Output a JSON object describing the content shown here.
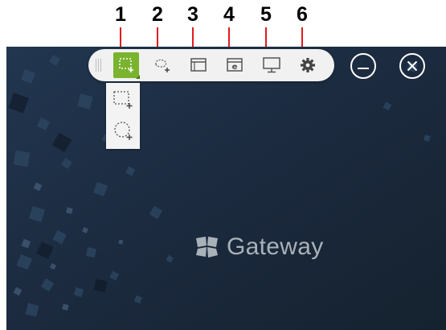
{
  "callouts": [
    "1",
    "2",
    "3",
    "4",
    "5",
    "6"
  ],
  "toolbar": {
    "buttons": [
      {
        "id": "rect-region",
        "icon": "rect-region-capture-icon",
        "active": true
      },
      {
        "id": "free-region",
        "icon": "freeform-region-capture-icon",
        "active": false
      },
      {
        "id": "window",
        "icon": "window-capture-icon",
        "active": false
      },
      {
        "id": "browser",
        "icon": "browser-capture-icon",
        "active": false
      },
      {
        "id": "fullscreen",
        "icon": "fullscreen-capture-icon",
        "active": false
      },
      {
        "id": "settings",
        "icon": "gear-icon",
        "active": false
      }
    ]
  },
  "window_controls": {
    "minimize_icon": "minimize-icon",
    "close_icon": "close-icon"
  },
  "dropdown": {
    "items": [
      "rect-region-option-icon",
      "ellipse-region-option-icon"
    ]
  },
  "logo": {
    "text": "Gateway",
    "icon": "gateway-logo-icon"
  },
  "colors": {
    "accent": "#7ab32e",
    "background": "#1b2a3e",
    "callout_line": "#e21b1b"
  }
}
